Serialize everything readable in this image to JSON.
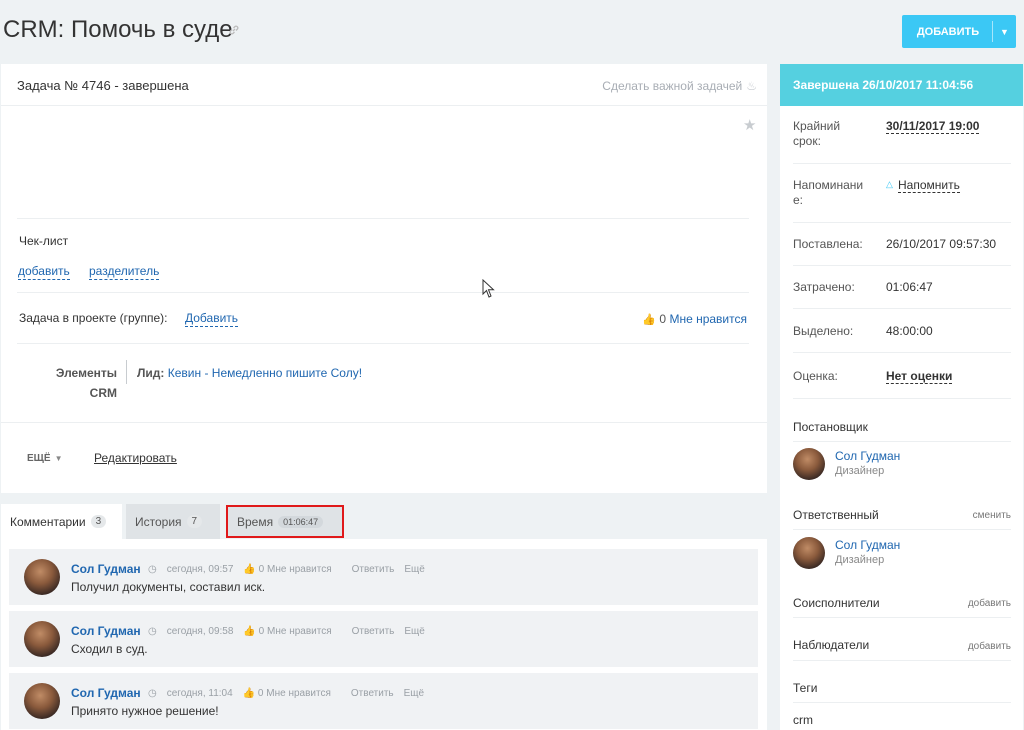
{
  "header": {
    "title": "CRM: Помочь в суде",
    "link_icon": "link-icon",
    "add_button": "ДОБАВИТЬ",
    "accent": "#3bc8f5"
  },
  "task": {
    "title": "Задача № 4746 - завершена",
    "make_important": "Сделать важной задачей",
    "checklist_label": "Чек-лист",
    "checklist_add": "добавить",
    "checklist_separator": "разделитель",
    "project_label": "Задача в проекте (группе):",
    "project_add": "Добавить",
    "likes_count": "0",
    "likes_label": "Мне нравится",
    "crm_label_1": "Элементы",
    "crm_label_2": "CRM",
    "crm_lead_label": "Лид:",
    "crm_lead_value": "Кевин - Немедленно пишите Солу!",
    "more_label": "ЕЩЁ",
    "edit_label": "Редактировать"
  },
  "tabs": [
    {
      "label": "Комментарии",
      "count": "3"
    },
    {
      "label": "История",
      "count": "7"
    },
    {
      "label": "Время",
      "count": "01:06:47"
    }
  ],
  "comments": [
    {
      "author": "Сол Гудман",
      "time": "сегодня, 09:57",
      "likes": "0 Мне нравится",
      "reply": "Ответить",
      "more": "Ещё",
      "text": "Получил документы, составил иск."
    },
    {
      "author": "Сол Гудман",
      "time": "сегодня, 09:58",
      "likes": "0 Мне нравится",
      "reply": "Ответить",
      "more": "Ещё",
      "text": "Сходил в суд."
    },
    {
      "author": "Сол Гудман",
      "time": "сегодня, 11:04",
      "likes": "0 Мне нравится",
      "reply": "Ответить",
      "more": "Ещё",
      "text": "Принято нужное решение!"
    }
  ],
  "sidebar": {
    "status": "Завершена 26/10/2017 11:04:56",
    "status_color": "#55d0e0",
    "deadline_label_1": "Крайний",
    "deadline_label_2": "срок:",
    "deadline_value": "30/11/2017 19:00",
    "reminder_label_1": "Напоминани",
    "reminder_label_2": "е:",
    "reminder_value": "Напомнить",
    "created_label": "Поставлена:",
    "created_value": "26/10/2017 09:57:30",
    "spent_label": "Затрачено:",
    "spent_value": "01:06:47",
    "allocated_label": "Выделено:",
    "allocated_value": "48:00:00",
    "rating_label": "Оценка:",
    "rating_value": "Нет оценки",
    "creator_title": "Постановщик",
    "creator_name": "Сол Гудман",
    "creator_position": "Дизайнер",
    "responsible_title": "Ответственный",
    "responsible_change": "сменить",
    "responsible_name": "Сол Гудман",
    "responsible_position": "Дизайнер",
    "coexecutors_title": "Соисполнители",
    "coexecutors_add": "добавить",
    "observers_title": "Наблюдатели",
    "observers_add": "добавить",
    "tags_title": "Теги",
    "tag_value": "crm"
  }
}
